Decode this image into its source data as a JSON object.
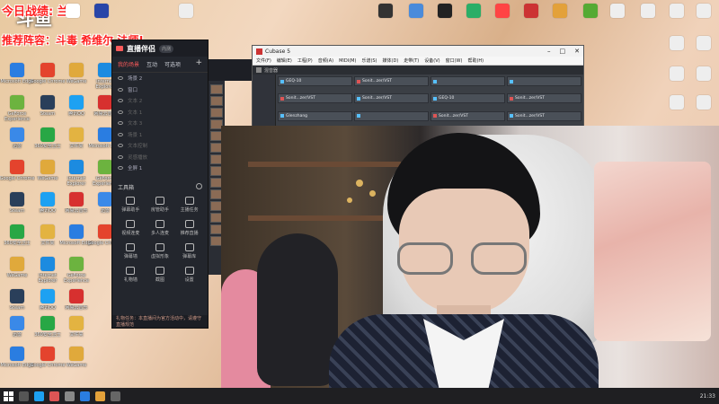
{
  "overlay": {
    "line1": "今日战绩:",
    "line1_tail": "兰",
    "line2": "推荐阵容：斗毒 希维尔 法师!",
    "logo": "斗鱼"
  },
  "desktop_icons_left": [
    {
      "label": "Microsoft Edge",
      "color": "#2a7de1"
    },
    {
      "label": "Google Chrome",
      "color": "#e4432d"
    },
    {
      "label": "WeGame",
      "color": "#e0a93b"
    },
    {
      "label": "Internet Explorer",
      "color": "#1c8be0"
    },
    {
      "label": "GeForce Experience",
      "color": "#6cb33f"
    },
    {
      "label": "Steam",
      "color": "#2a3f5a"
    },
    {
      "label": "腾讯QQ",
      "color": "#1da1f2"
    },
    {
      "label": "网易云音乐",
      "color": "#d7302f"
    },
    {
      "label": "迅雷",
      "color": "#3a89e8"
    },
    {
      "label": "360安全卫士",
      "color": "#28a745"
    },
    {
      "label": "文件夹",
      "color": "#e3b341"
    }
  ],
  "streaming_app": {
    "logo": "直播伴侣",
    "version": "内测",
    "tabs": [
      "我的场景",
      "互动",
      "可选项"
    ],
    "scenes": [
      "场景 2",
      "窗口",
      "文本 2",
      "文本 1",
      "文本 3",
      "场景 1",
      "文本控制",
      "灵感播放",
      "全屏 1"
    ],
    "tools_title": "工具箱",
    "tools": [
      "弹幕助手",
      "房管助手",
      "主播任务",
      "视频连麦",
      "多人连麦",
      "推荐直播",
      "弹幕墙",
      "虚拟形象",
      "弹幕库",
      "礼物墙",
      "截图",
      "设置"
    ],
    "footer": "礼物任务：本直播间为官方活动中，请遵守直播规范"
  },
  "cubase": {
    "title": "Cubase 5",
    "menu": [
      "文件(F)",
      "编辑(E)",
      "工程(P)",
      "音频(A)",
      "MIDI(M)",
      "乐谱(S)",
      "媒体(D)",
      "走带(T)",
      "设备(V)",
      "窗口(W)",
      "帮助(H)"
    ],
    "submenu": "混音器",
    "cells": [
      "GEQ-10",
      "Sonit...zer/VST",
      "",
      "",
      "Sonit...zer/VST",
      "Sonit...zer/VST",
      "GEQ-10",
      "Sonit...zer/VST",
      "Glenzhang",
      "",
      "Sonit...zer/VST",
      "Sonit...zer/VST"
    ]
  },
  "taskbar": {
    "tray": "21:33"
  }
}
